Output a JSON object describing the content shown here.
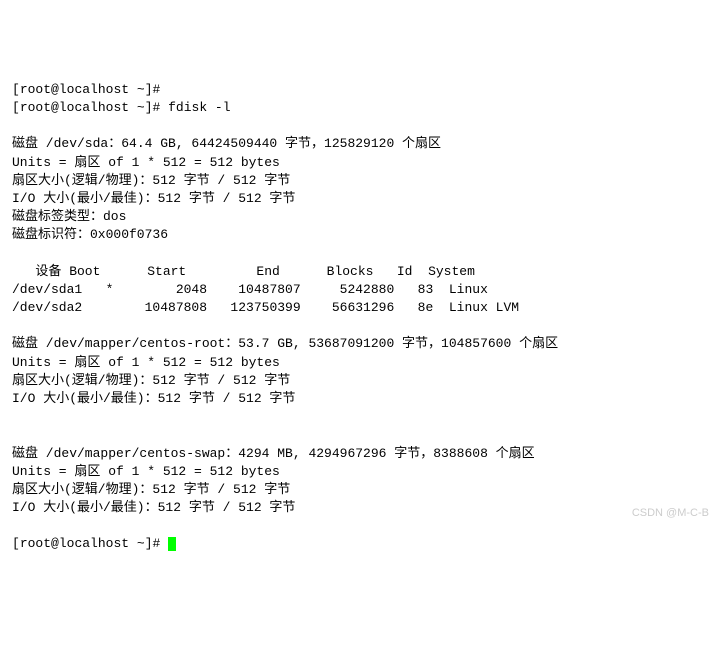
{
  "prompt_user": "root",
  "prompt_host": "localhost",
  "prompt_path": "~",
  "prompt_symbol": "#",
  "command": "fdisk -l",
  "disk_sda": {
    "header": "磁盘 /dev/sda：64.4 GB, 64424509440 字节，125829120 个扇区",
    "units": "Units = 扇区 of 1 * 512 = 512 bytes",
    "sector_size": "扇区大小(逻辑/物理)：512 字节 / 512 字节",
    "io_size": "I/O 大小(最小/最佳)：512 字节 / 512 字节",
    "label_type": "磁盘标签类型：dos",
    "identifier": "磁盘标识符：0x000f0736"
  },
  "partition_table": {
    "header": "   设备 Boot      Start         End      Blocks   Id  System",
    "row1": "/dev/sda1   *        2048    10487807     5242880   83  Linux",
    "row2": "/dev/sda2        10487808   123750399    56631296   8e  Linux LVM"
  },
  "disk_root": {
    "header": "磁盘 /dev/mapper/centos-root：53.7 GB, 53687091200 字节，104857600 个扇区",
    "units": "Units = 扇区 of 1 * 512 = 512 bytes",
    "sector_size": "扇区大小(逻辑/物理)：512 字节 / 512 字节",
    "io_size": "I/O 大小(最小/最佳)：512 字节 / 512 字节"
  },
  "disk_swap": {
    "header": "磁盘 /dev/mapper/centos-swap：4294 MB, 4294967296 字节，8388608 个扇区",
    "units": "Units = 扇区 of 1 * 512 = 512 bytes",
    "sector_size": "扇区大小(逻辑/物理)：512 字节 / 512 字节",
    "io_size": "I/O 大小(最小/最佳)：512 字节 / 512 字节"
  },
  "watermark": "CSDN @M-C-B"
}
